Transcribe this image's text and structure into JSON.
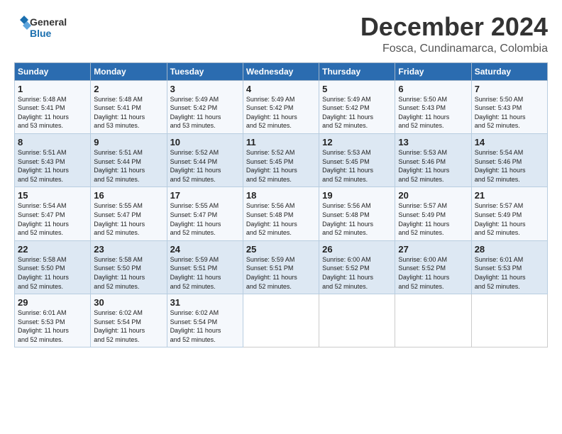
{
  "header": {
    "logo_general": "General",
    "logo_blue": "Blue",
    "title": "December 2024",
    "subtitle": "Fosca, Cundinamarca, Colombia"
  },
  "days_of_week": [
    "Sunday",
    "Monday",
    "Tuesday",
    "Wednesday",
    "Thursday",
    "Friday",
    "Saturday"
  ],
  "weeks": [
    {
      "days": [
        {
          "num": "1",
          "rise": "5:48 AM",
          "set": "5:41 PM",
          "daylight": "11 hours and 53 minutes."
        },
        {
          "num": "2",
          "rise": "5:48 AM",
          "set": "5:41 PM",
          "daylight": "11 hours and 53 minutes."
        },
        {
          "num": "3",
          "rise": "5:49 AM",
          "set": "5:42 PM",
          "daylight": "11 hours and 53 minutes."
        },
        {
          "num": "4",
          "rise": "5:49 AM",
          "set": "5:42 PM",
          "daylight": "11 hours and 52 minutes."
        },
        {
          "num": "5",
          "rise": "5:49 AM",
          "set": "5:42 PM",
          "daylight": "11 hours and 52 minutes."
        },
        {
          "num": "6",
          "rise": "5:50 AM",
          "set": "5:43 PM",
          "daylight": "11 hours and 52 minutes."
        },
        {
          "num": "7",
          "rise": "5:50 AM",
          "set": "5:43 PM",
          "daylight": "11 hours and 52 minutes."
        }
      ]
    },
    {
      "days": [
        {
          "num": "8",
          "rise": "5:51 AM",
          "set": "5:43 PM",
          "daylight": "11 hours and 52 minutes."
        },
        {
          "num": "9",
          "rise": "5:51 AM",
          "set": "5:44 PM",
          "daylight": "11 hours and 52 minutes."
        },
        {
          "num": "10",
          "rise": "5:52 AM",
          "set": "5:44 PM",
          "daylight": "11 hours and 52 minutes."
        },
        {
          "num": "11",
          "rise": "5:52 AM",
          "set": "5:45 PM",
          "daylight": "11 hours and 52 minutes."
        },
        {
          "num": "12",
          "rise": "5:53 AM",
          "set": "5:45 PM",
          "daylight": "11 hours and 52 minutes."
        },
        {
          "num": "13",
          "rise": "5:53 AM",
          "set": "5:46 PM",
          "daylight": "11 hours and 52 minutes."
        },
        {
          "num": "14",
          "rise": "5:54 AM",
          "set": "5:46 PM",
          "daylight": "11 hours and 52 minutes."
        }
      ]
    },
    {
      "days": [
        {
          "num": "15",
          "rise": "5:54 AM",
          "set": "5:47 PM",
          "daylight": "11 hours and 52 minutes."
        },
        {
          "num": "16",
          "rise": "5:55 AM",
          "set": "5:47 PM",
          "daylight": "11 hours and 52 minutes."
        },
        {
          "num": "17",
          "rise": "5:55 AM",
          "set": "5:47 PM",
          "daylight": "11 hours and 52 minutes."
        },
        {
          "num": "18",
          "rise": "5:56 AM",
          "set": "5:48 PM",
          "daylight": "11 hours and 52 minutes."
        },
        {
          "num": "19",
          "rise": "5:56 AM",
          "set": "5:48 PM",
          "daylight": "11 hours and 52 minutes."
        },
        {
          "num": "20",
          "rise": "5:57 AM",
          "set": "5:49 PM",
          "daylight": "11 hours and 52 minutes."
        },
        {
          "num": "21",
          "rise": "5:57 AM",
          "set": "5:49 PM",
          "daylight": "11 hours and 52 minutes."
        }
      ]
    },
    {
      "days": [
        {
          "num": "22",
          "rise": "5:58 AM",
          "set": "5:50 PM",
          "daylight": "11 hours and 52 minutes."
        },
        {
          "num": "23",
          "rise": "5:58 AM",
          "set": "5:50 PM",
          "daylight": "11 hours and 52 minutes."
        },
        {
          "num": "24",
          "rise": "5:59 AM",
          "set": "5:51 PM",
          "daylight": "11 hours and 52 minutes."
        },
        {
          "num": "25",
          "rise": "5:59 AM",
          "set": "5:51 PM",
          "daylight": "11 hours and 52 minutes."
        },
        {
          "num": "26",
          "rise": "6:00 AM",
          "set": "5:52 PM",
          "daylight": "11 hours and 52 minutes."
        },
        {
          "num": "27",
          "rise": "6:00 AM",
          "set": "5:52 PM",
          "daylight": "11 hours and 52 minutes."
        },
        {
          "num": "28",
          "rise": "6:01 AM",
          "set": "5:53 PM",
          "daylight": "11 hours and 52 minutes."
        }
      ]
    },
    {
      "days": [
        {
          "num": "29",
          "rise": "6:01 AM",
          "set": "5:53 PM",
          "daylight": "11 hours and 52 minutes."
        },
        {
          "num": "30",
          "rise": "6:02 AM",
          "set": "5:54 PM",
          "daylight": "11 hours and 52 minutes."
        },
        {
          "num": "31",
          "rise": "6:02 AM",
          "set": "5:54 PM",
          "daylight": "11 hours and 52 minutes."
        },
        null,
        null,
        null,
        null
      ]
    }
  ],
  "labels": {
    "sunrise": "Sunrise:",
    "sunset": "Sunset:",
    "daylight": "Daylight:"
  }
}
